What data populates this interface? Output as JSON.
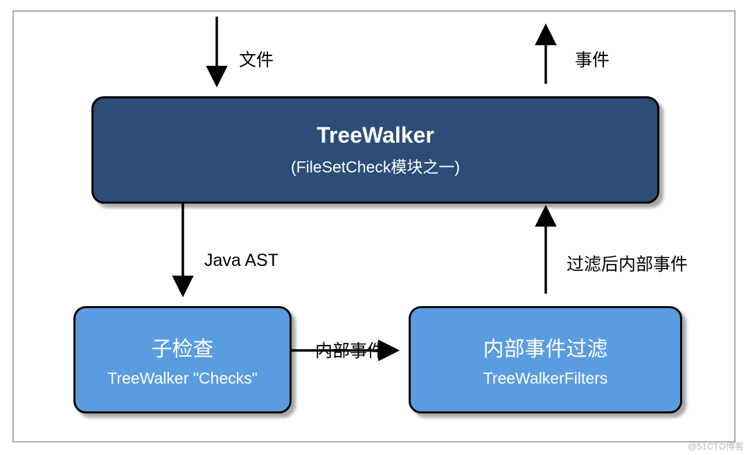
{
  "treewalker": {
    "title": "TreeWalker",
    "subtitle": "(FileSetCheck模块之一)"
  },
  "checks": {
    "title": "子检查",
    "subtitle": "TreeWalker \"Checks\""
  },
  "filters": {
    "title": "内部事件过滤",
    "subtitle": "TreeWalkerFilters"
  },
  "labels": {
    "file_in": "文件",
    "event_out": "事件",
    "java_ast": "Java AST",
    "inner_events": "内部事件",
    "filtered_events": "过滤后内部事件"
  },
  "watermark": "@51CTO博客"
}
